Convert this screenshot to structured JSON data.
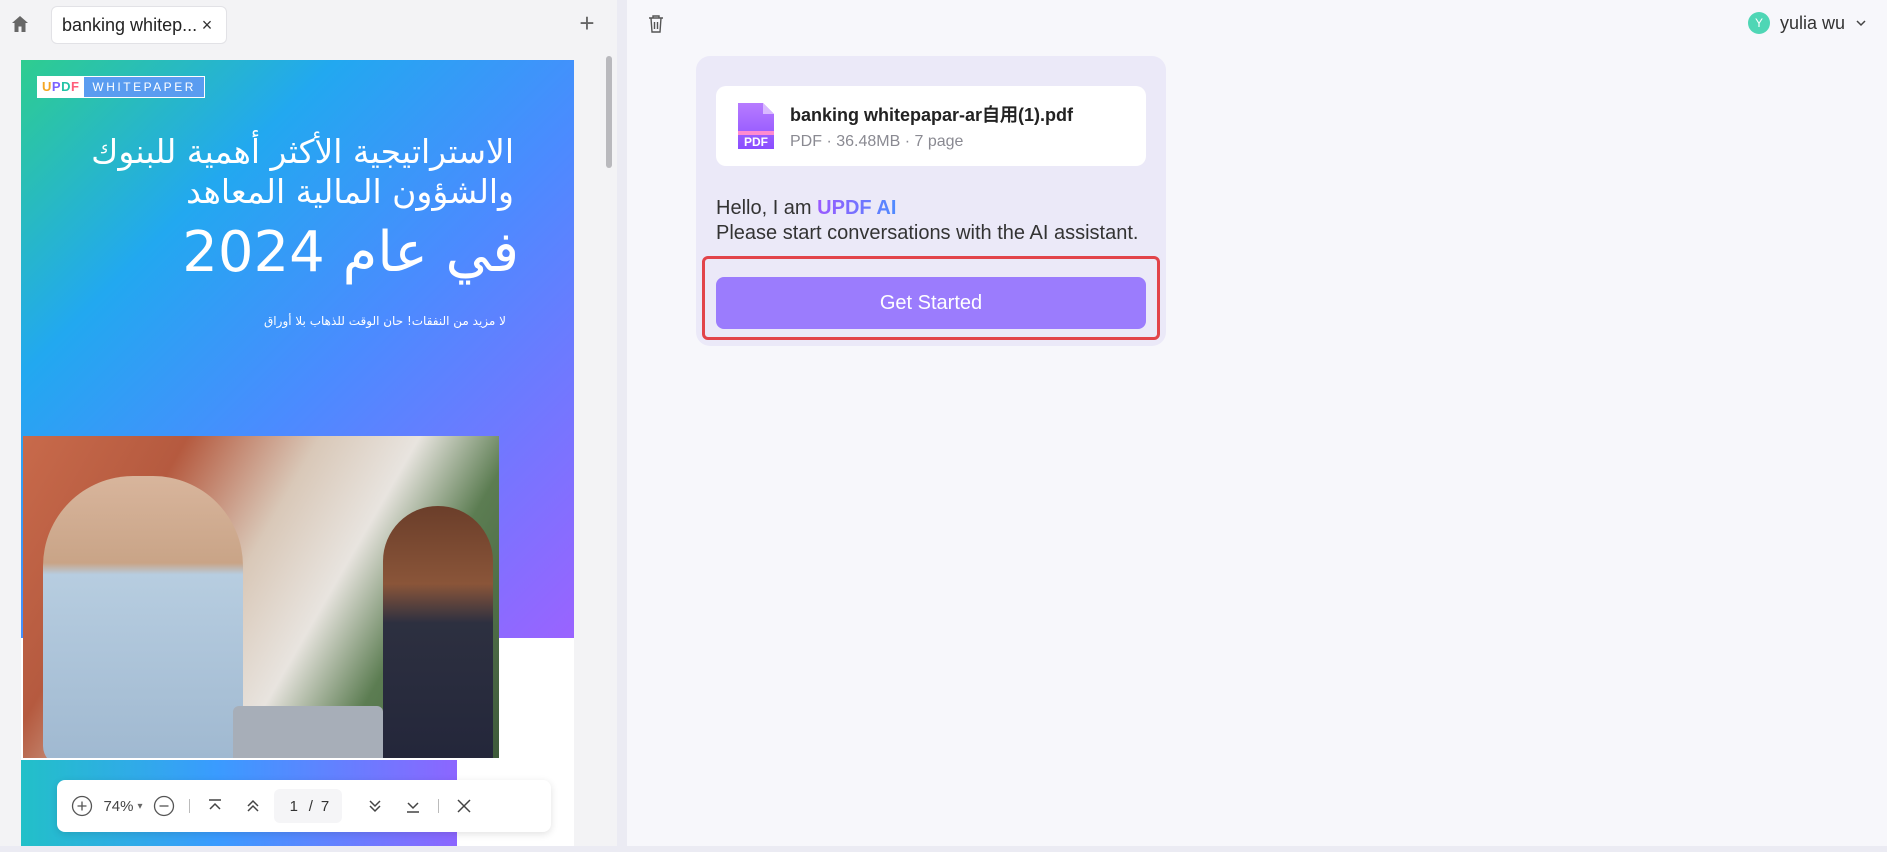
{
  "tab": {
    "title": "banking whitep...",
    "close": "×"
  },
  "add_tab": "+",
  "document": {
    "logo_updf": [
      "U",
      "P",
      "D",
      "F"
    ],
    "logo_whitepaper": "WHITEPAPER",
    "heading_line1": "الاستراتيجية الأكثر أهمية للبنوك",
    "heading_line2": "والشؤون المالية المعاهد",
    "heading_line3": "في عام 2024",
    "subheading": "لا مزيد من النفقات! حان الوقت للذهاب بلا أوراق"
  },
  "zoom_bar": {
    "zoom": "74%",
    "current_page": "1",
    "separator": "/",
    "total_pages": "7"
  },
  "user": {
    "initial": "Y",
    "name": "yulia wu"
  },
  "file": {
    "name": "banking whitepapar-ar自用(1).pdf",
    "meta": "PDF · 36.48MB · 7 page",
    "icon_label": "PDF"
  },
  "greeting": {
    "prefix": "Hello, I am ",
    "brand": "UPDF AI",
    "line2": "Please start conversations with the AI assistant."
  },
  "get_started_label": "Get Started",
  "colors": {
    "accent": "#9b7cfd",
    "highlight": "#e2444a",
    "avatar": "#4fd6b5"
  }
}
